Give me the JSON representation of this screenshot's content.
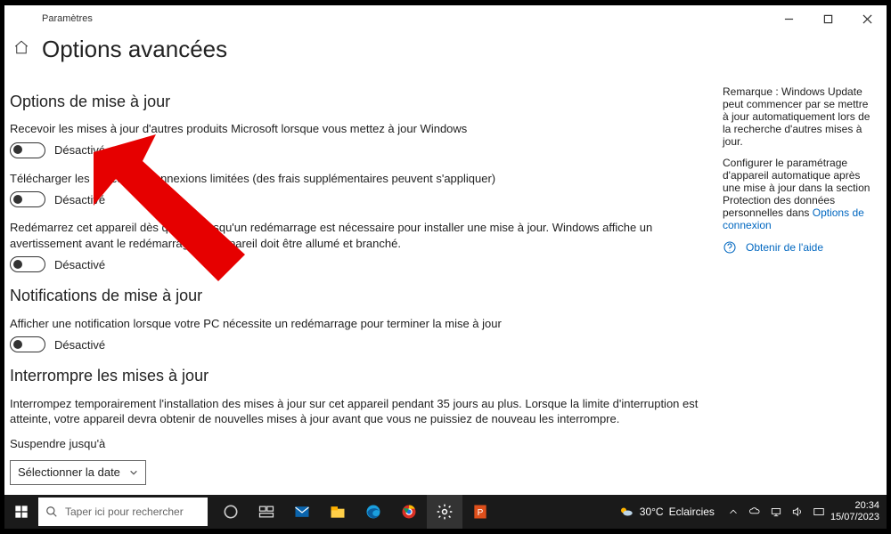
{
  "window": {
    "app_name": "Paramètres",
    "page_title": "Options avancées"
  },
  "sections": {
    "update_options": {
      "heading": "Options de mise à jour",
      "opt1": {
        "label": "Recevoir les mises à jour d'autres produits Microsoft lorsque vous mettez à jour Windows",
        "state": "Désactivé"
      },
      "opt2": {
        "label": "Télécharger les mises                   des connexions limitées (des frais supplémentaires peuvent s'appliquer)",
        "state": "Désactivé"
      },
      "opt3": {
        "label": "Redémarrez cet appareil dès que po           lorsqu'un redémarrage est nécessaire pour installer une mise à jour. Windows affiche un avertissement avant le redémarrage et l'appareil doit être allumé et branché.",
        "state": "Désactivé"
      }
    },
    "notifications": {
      "heading": "Notifications de mise à jour",
      "opt1": {
        "label": "Afficher une notification lorsque votre PC nécessite un redémarrage pour terminer la mise à jour",
        "state": "Désactivé"
      }
    },
    "pause": {
      "heading": "Interrompre les mises à jour",
      "desc": "Interrompez temporairement l'installation des mises à jour sur cet appareil pendant 35 jours au plus. Lorsque la limite d'interruption est atteinte, votre appareil devra obtenir de nouvelles mises à jour avant que vous ne puissiez de nouveau les interrompre.",
      "suspend_label": "Suspendre jusqu'à",
      "select_placeholder": "Sélectionner la date"
    }
  },
  "sidebar": {
    "note": "Remarque : Windows Update peut commencer par se mettre à jour automatiquement lors de la recherche d'autres mises à jour.",
    "config_text": "Configurer le paramétrage d'appareil automatique après une mise à jour dans la section Protection des données personnelles dans",
    "config_link": "Options de connexion",
    "help_label": "Obtenir de l'aide"
  },
  "taskbar": {
    "search_placeholder": "Taper ici pour rechercher",
    "weather_temp": "30°C",
    "weather_desc": "Eclaircies",
    "time": "20:34",
    "date": "15/07/2023"
  }
}
